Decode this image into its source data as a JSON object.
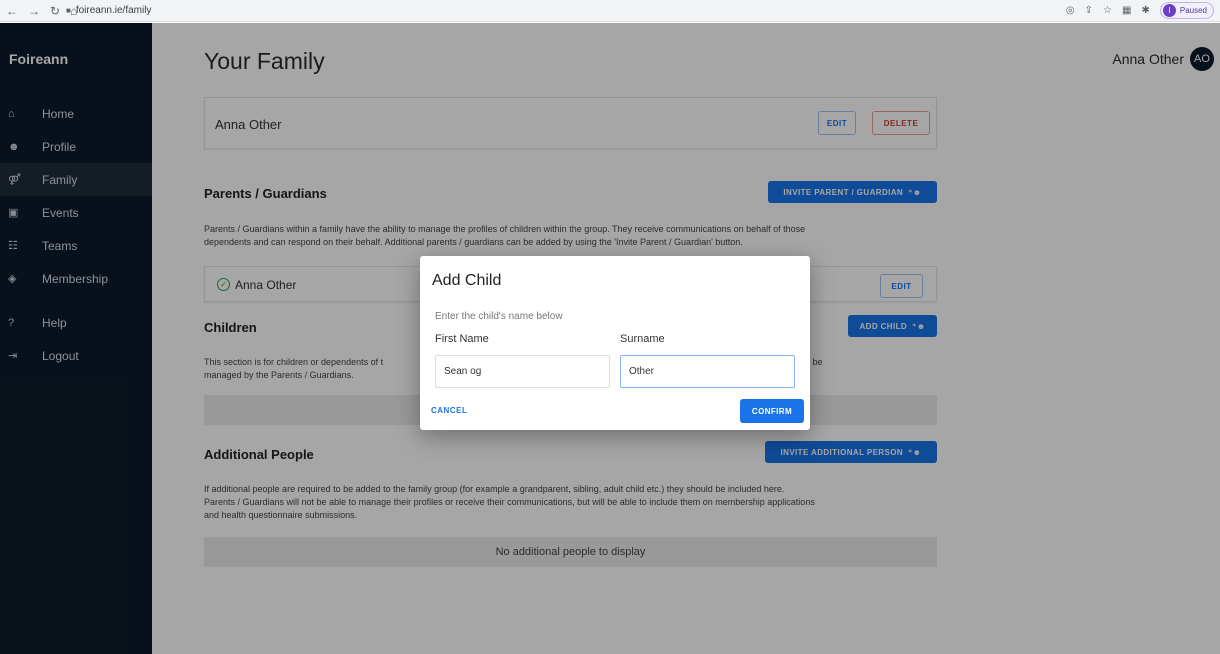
{
  "browser": {
    "url": "foireann.ie/family",
    "paused_label": "Paused",
    "profile_initial": "I",
    "nav_icons": [
      "back-icon",
      "forward-icon",
      "reload-icon",
      "home-icon"
    ]
  },
  "sidebar": {
    "brand": "Foireann",
    "items": [
      {
        "label": "Home",
        "icon": "home-icon",
        "glyph": "⌂"
      },
      {
        "label": "Profile",
        "icon": "person-icon",
        "glyph": "☻"
      },
      {
        "label": "Family",
        "icon": "family-icon",
        "glyph": "⚤",
        "active": true
      },
      {
        "label": "Events",
        "icon": "calendar-icon",
        "glyph": "▣"
      },
      {
        "label": "Teams",
        "icon": "group-icon",
        "glyph": "☷"
      },
      {
        "label": "Membership",
        "icon": "shield-icon",
        "glyph": "◈"
      },
      {
        "label": "Help",
        "icon": "help-icon",
        "glyph": "?"
      },
      {
        "label": "Logout",
        "icon": "logout-icon",
        "glyph": "⇥"
      }
    ]
  },
  "header": {
    "title": "Your Family",
    "user_name": "Anna Other",
    "user_initials": "AO"
  },
  "family_card": {
    "name": "Anna Other",
    "edit_label": "EDIT",
    "delete_label": "DELETE"
  },
  "parents": {
    "title": "Parents / Guardians",
    "invite_label": "INVITE PARENT / GUARDIAN",
    "description_line1": "Parents / Guardians within a family have the ability to manage the profiles of children within the group. They receive communications on behalf of those",
    "description_line2": "dependents and can respond on their behalf. Additional parents / guardians can be added by using the 'Invite Parent / Guardian' button.",
    "members": [
      {
        "name": "Anna Other",
        "edit_label": "EDIT"
      }
    ]
  },
  "children": {
    "title": "Children",
    "add_label": "ADD CHILD",
    "description_left1": "This section is for children or dependents of t",
    "description_right1": "nications etc) can be",
    "description_line2": "managed by the Parents / Guardians."
  },
  "additional": {
    "title": "Additional People",
    "invite_label": "INVITE ADDITIONAL PERSON",
    "description_line1": "If additional people are required to be added to the family group (for example a grandparent, sibling, adult child etc.) they should be included here.",
    "description_line2": "Parents / Guardians will not be able to manage their profiles or receive their communications, but will be able to include them on membership applications",
    "description_line3": "and health questionnaire submissions.",
    "empty_text": "No additional people to display"
  },
  "modal": {
    "title": "Add Child",
    "subtitle": "Enter the child's name below",
    "first_name_label": "First Name",
    "first_name_value": "Sean og",
    "surname_label": "Surname",
    "surname_value": "Other",
    "cancel_label": "CANCEL",
    "confirm_label": "CONFIRM"
  },
  "colors": {
    "sidebar_bg": "#0d1b2a",
    "primary": "#1a73e8",
    "danger": "#d23b3b",
    "success": "#2e9b47"
  }
}
